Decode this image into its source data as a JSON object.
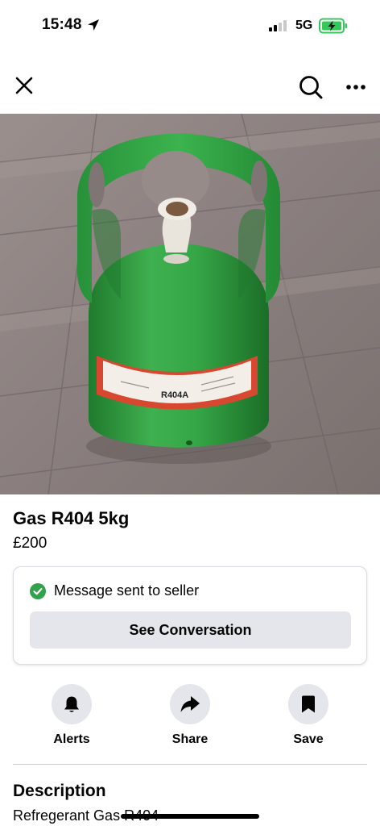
{
  "status_bar": {
    "time": "15:48",
    "network": "5G",
    "battery_charging": true
  },
  "icons": {
    "close": "close-icon",
    "search": "search-icon",
    "more": "more-icon",
    "alerts": "bell-icon",
    "share": "share-arrow-icon",
    "save": "bookmark-icon"
  },
  "gallery": {
    "image_count": 2,
    "active_index": 0
  },
  "listing": {
    "title": "Gas R404 5kg",
    "price": "£200"
  },
  "cylinder_label": {
    "text": "R404A"
  },
  "message_card": {
    "status_text": "Message sent to seller",
    "button_label": "See Conversation"
  },
  "actions": [
    {
      "label": "Alerts"
    },
    {
      "label": "Share"
    },
    {
      "label": "Save"
    }
  ],
  "description": {
    "heading": "Description",
    "text": "Refregerant Gas R404"
  },
  "colors": {
    "check_green": "#31a24c",
    "button_grey": "#e4e6eb",
    "cylinder_green": "#2e9e3f"
  }
}
